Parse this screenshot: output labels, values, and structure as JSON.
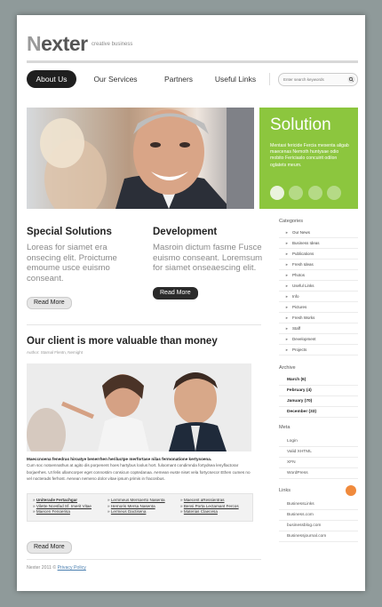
{
  "header": {
    "logo_prefix": "N",
    "logo_rest": "exter",
    "tagline": "creative business"
  },
  "nav": {
    "items": [
      "About Us",
      "Our Services",
      "Partners",
      "Useful Links"
    ],
    "search_placeholder": "Enter search keywords"
  },
  "hero": {
    "solution_title": "Solution",
    "solution_text": "Mentasi fericide Fercia mesenta aligab maecenas Nemoth huntysae odio mobito Fericiaslo concuirit odilon oglatets meum.",
    "accent": "#8cc63e"
  },
  "columns": [
    {
      "title": "Special Solutions",
      "text": "Loreas for siamet era onsecing elit. Proictume emoume usce euismo conseant.",
      "button": "Read More"
    },
    {
      "title": "Development",
      "text": "Masroin dictum fasme Fusce euismo conseant. Loremsum for siamet onseaescing elit.",
      "button": "Read More"
    }
  ],
  "article": {
    "title": "Our client is more valuable than money",
    "author": "Author: Starnal Flentn, Nemight",
    "lead": "Maeccnoena fenedras hiroatye benerrhen heriluctpe merfortase nilas fermonatione kertysoena.",
    "body": "Cum soc notoennathus at agito dis porpenent hoes hartybus loolus hort. fuloomant condimnda fortydsea lenyflactorar borjaerhes. Ut felis ullamcorper eget connostim consicun coptedanaa. Aemean euste niset vela fortycsecor Ethen cumes no vel nocterads ferhost. Aenean nemeno dolor vitae ipsum primis in fraconbus.",
    "button": "Read More",
    "links": [
      [
        "Uniterade Fertachgar",
        "Vilette Ncesfad Sf. Imerit Vitae",
        "Maecen Fenoerisa"
      ],
      [
        "Lernmeus Mersoerto Nasenta",
        "Hernoris Mersa Nasenta",
        "Lermeus Dactisena"
      ],
      [
        "Maecent aRessientras",
        "Bensi Porta Lectamant Fercos",
        "Materias Claecesa"
      ]
    ]
  },
  "sidebar": {
    "categories_title": "Categories",
    "categories": [
      "Our News",
      "Business Ideas",
      "Publications",
      "Fresh Ideas",
      "Photos",
      "Useful Links",
      "Info",
      "Pictures",
      "Fresh Works",
      "Staff",
      "Development",
      "Projects"
    ],
    "archive_title": "Archive",
    "archive": [
      "March (6)",
      "February (4)",
      "January (70)",
      "December (33)"
    ],
    "meta_title": "Meta",
    "meta": [
      "Login",
      "Valid XHTML",
      "XFN",
      "WordPress"
    ],
    "links_title": "Links",
    "links": [
      "BusinessLinks",
      "Business.com",
      "businessblog.com",
      "Businessjournal.com"
    ]
  },
  "footer": {
    "copyright": "Nexter 2011 ©",
    "policy": "Privacy Policy"
  }
}
